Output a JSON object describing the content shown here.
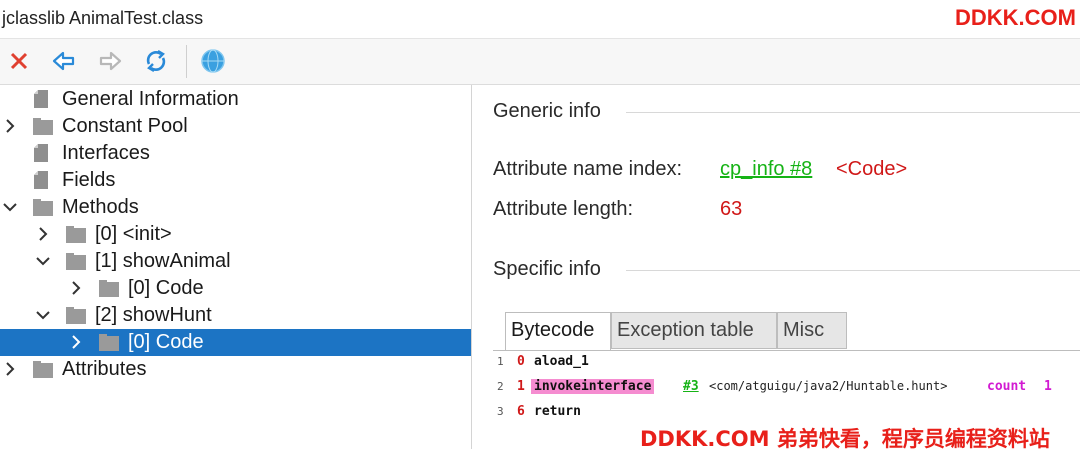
{
  "window": {
    "title": "jclasslib AnimalTest.class"
  },
  "branding": {
    "top_right": "DDKK.COM",
    "bottom": "DDKK.COM 弟弟快看，程序员编程资料站"
  },
  "toolbar": {
    "buttons": [
      {
        "name": "close",
        "icon": "close-x-icon",
        "color": "#e04030"
      },
      {
        "name": "back",
        "icon": "arrow-left-icon",
        "color": "#2a8ad8"
      },
      {
        "name": "forward",
        "icon": "arrow-right-icon",
        "color": "#b8b8b8"
      },
      {
        "name": "reload",
        "icon": "reload-icon",
        "color": "#2a8ad8"
      },
      {
        "name": "web",
        "icon": "globe-icon",
        "color": "#3aa0e0"
      }
    ]
  },
  "tree": {
    "items": [
      {
        "label": "General Information",
        "indent": 0,
        "expander": "none",
        "icon": "page"
      },
      {
        "label": "Constant Pool",
        "indent": 0,
        "expander": "collapsed",
        "icon": "folder"
      },
      {
        "label": "Interfaces",
        "indent": 0,
        "expander": "none",
        "icon": "page"
      },
      {
        "label": "Fields",
        "indent": 0,
        "expander": "none",
        "icon": "page"
      },
      {
        "label": "Methods",
        "indent": 0,
        "expander": "expanded",
        "icon": "folder"
      },
      {
        "label": "[0] <init>",
        "indent": 1,
        "expander": "collapsed",
        "icon": "folder"
      },
      {
        "label": "[1] showAnimal",
        "indent": 1,
        "expander": "expanded",
        "icon": "folder"
      },
      {
        "label": "[0] Code",
        "indent": 2,
        "expander": "collapsed",
        "icon": "folder"
      },
      {
        "label": "[2] showHunt",
        "indent": 1,
        "expander": "expanded",
        "icon": "folder"
      },
      {
        "label": "[0] Code",
        "indent": 2,
        "expander": "collapsed",
        "icon": "folder",
        "selected": true
      },
      {
        "label": "Attributes",
        "indent": 0,
        "expander": "collapsed",
        "icon": "folder"
      }
    ]
  },
  "detail": {
    "generic": {
      "title": "Generic info",
      "name_index_label": "Attribute name index:",
      "name_index_link": "cp_info #8",
      "name_index_value": "<Code>",
      "length_label": "Attribute length:",
      "length_value": "63"
    },
    "specific": {
      "title": "Specific info"
    },
    "tabs": [
      {
        "label": "Bytecode",
        "active": true
      },
      {
        "label": "Exception table",
        "active": false
      },
      {
        "label": "Misc",
        "active": false
      }
    ],
    "bytecode": [
      {
        "line": "1",
        "offset": "0",
        "op": "aload_1"
      },
      {
        "line": "2",
        "offset": "1",
        "op": "invokeinterface",
        "arg": "#3",
        "cls": "<com/atguigu/java2/Huntable.hunt>",
        "kw": "count",
        "num": "1"
      },
      {
        "line": "3",
        "offset": "6",
        "op": "return"
      }
    ]
  }
}
